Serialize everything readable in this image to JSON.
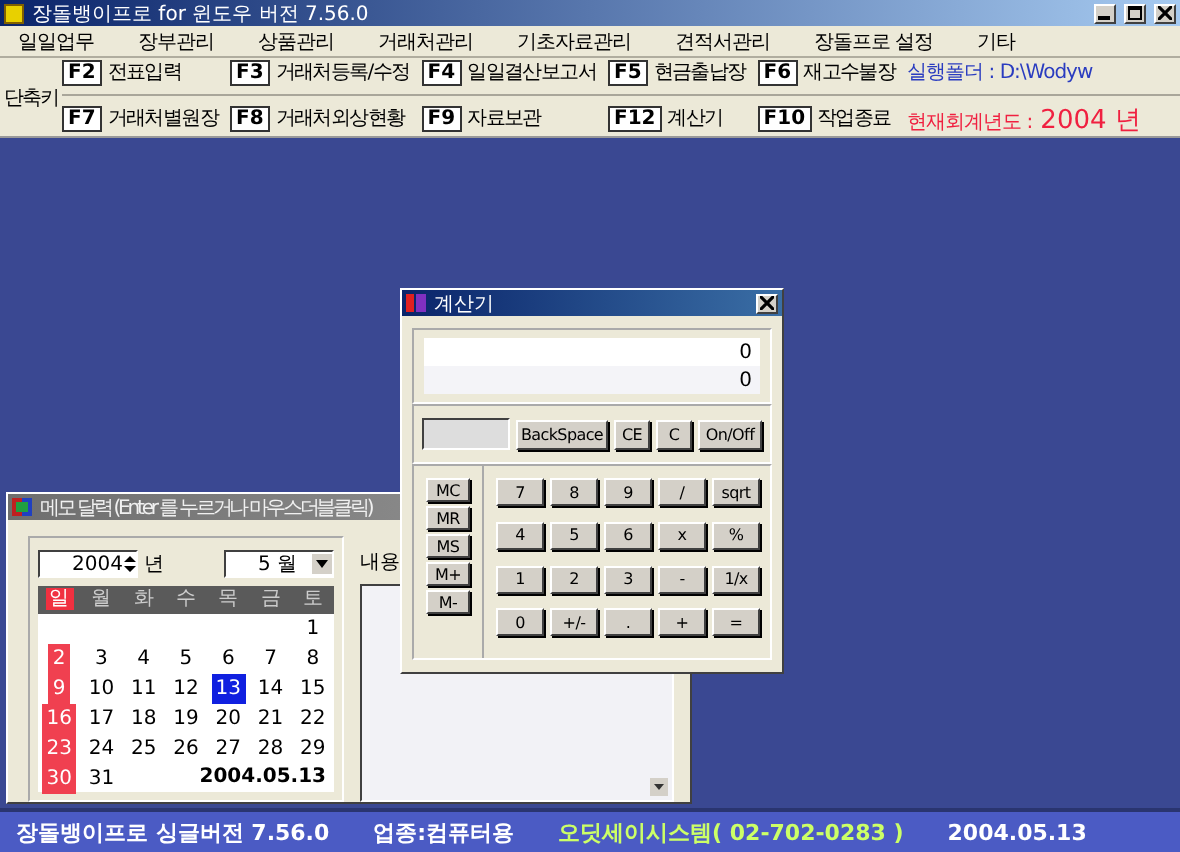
{
  "window": {
    "title": "장돌뱅이프로 for 윈도우 버전 7.56.0"
  },
  "menu": [
    "일일업무",
    "장부관리",
    "상품관리",
    "거래처관리",
    "기초자료관리",
    "견적서관리",
    "장돌프로 설정",
    "기타"
  ],
  "shortcuts": {
    "label": "단축키",
    "rows": [
      [
        {
          "key": "F2",
          "label": "전표입력"
        },
        {
          "key": "F3",
          "label": "거래처등록/수정"
        },
        {
          "key": "F4",
          "label": "일일결산보고서"
        },
        {
          "key": "F5",
          "label": "현금출납장"
        },
        {
          "key": "F6",
          "label": "재고수불장"
        }
      ],
      [
        {
          "key": "F7",
          "label": "거래처별원장"
        },
        {
          "key": "F8",
          "label": "거래처외상현황"
        },
        {
          "key": "F9",
          "label": "자료보관"
        },
        {
          "key": "F12",
          "label": "계산기"
        },
        {
          "key": "F10",
          "label": "작업종료"
        }
      ]
    ]
  },
  "folder_info": "실행폴더 : D:\\Wodyw",
  "fiscal_year": {
    "label": "현재회계년도 :",
    "value": "2004 년"
  },
  "memo": {
    "title": "메모 달력 (Enter 를 누르거나 마우스더블클릭)",
    "year": "2004",
    "year_unit": "년",
    "month": "5 월",
    "weekdays": [
      "일",
      "월",
      "화",
      "수",
      "목",
      "금",
      "토"
    ],
    "weeks": [
      [
        {
          "day": "1",
          "selected": false
        }
      ],
      [
        {
          "day": "2",
          "selected": false
        },
        {
          "day": "3",
          "selected": false
        },
        {
          "day": "4",
          "selected": false
        },
        {
          "day": "5",
          "selected": false
        },
        {
          "day": "6",
          "selected": false
        },
        {
          "day": "7",
          "selected": false
        },
        {
          "day": "8",
          "selected": false
        }
      ],
      [
        {
          "day": "9",
          "selected": false
        },
        {
          "day": "10",
          "selected": false
        },
        {
          "day": "11",
          "selected": false
        },
        {
          "day": "12",
          "selected": false
        },
        {
          "day": "13",
          "selected": true
        },
        {
          "day": "14",
          "selected": false
        },
        {
          "day": "15",
          "selected": false
        }
      ],
      [
        {
          "day": "16",
          "selected": false
        },
        {
          "day": "17",
          "selected": false
        },
        {
          "day": "18",
          "selected": false
        },
        {
          "day": "19",
          "selected": false
        },
        {
          "day": "20",
          "selected": false
        },
        {
          "day": "21",
          "selected": false
        },
        {
          "day": "22",
          "selected": false
        }
      ],
      [
        {
          "day": "23",
          "selected": false
        },
        {
          "day": "24",
          "selected": false
        },
        {
          "day": "25",
          "selected": false
        },
        {
          "day": "26",
          "selected": false
        },
        {
          "day": "27",
          "selected": false
        },
        {
          "day": "28",
          "selected": false
        },
        {
          "day": "29",
          "selected": false
        }
      ],
      [
        {
          "day": "30",
          "selected": false
        },
        {
          "day": "31",
          "selected": false
        }
      ]
    ],
    "date": "2004.05.13",
    "content_label": "내용"
  },
  "calculator": {
    "title": "계산기",
    "display": [
      "0",
      "0"
    ],
    "top_buttons": [
      "BackSpace",
      "CE",
      "C",
      "On/Off"
    ],
    "memory_buttons": [
      "MC",
      "MR",
      "MS",
      "M+",
      "M-"
    ],
    "keys": [
      [
        "7",
        "8",
        "9",
        "/",
        "sqrt"
      ],
      [
        "4",
        "5",
        "6",
        "x",
        "%"
      ],
      [
        "1",
        "2",
        "3",
        "-",
        "1/x"
      ],
      [
        "0",
        "+/-",
        ".",
        "+",
        "="
      ]
    ]
  },
  "status_bar": [
    {
      "text": "장돌뱅이프로 싱글버전 7.56.0",
      "color": "#ffffff"
    },
    {
      "text": "업종:컴퓨터용",
      "color": "#ffffff"
    },
    {
      "text": "오딧세이시스템( 02-702-0283 )",
      "color": "#ccff66"
    },
    {
      "text": "2004.05.13",
      "color": "#ffffff"
    }
  ]
}
